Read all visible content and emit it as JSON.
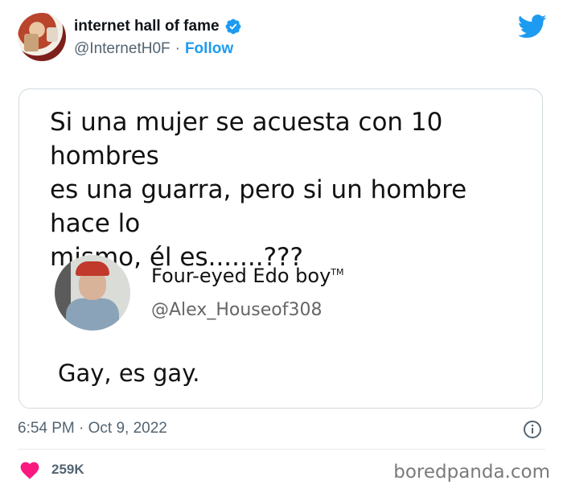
{
  "author": {
    "name": "internet hall of fame",
    "handle": "@InternetH0F",
    "separator": "·",
    "follow_label": "Follow",
    "avatar_icon": "avatar-image",
    "verified_icon": "verified-badge-icon"
  },
  "brand": {
    "logo_icon": "twitter-bird-icon",
    "color": "#1d9bf0"
  },
  "quoted": {
    "text": "Si una mujer se acuesta con 10 hombres\nes una guarra, pero si un hombre hace lo\nmismo, él es.......???",
    "reply_author_name": "Four-eyed Edo boy",
    "reply_author_tm": "TM",
    "reply_author_handle": "@Alex_Houseof308",
    "reply_text": "Gay, es gay."
  },
  "meta": {
    "timestamp": "6:54 PM · Oct 9, 2022",
    "info_icon": "info-icon",
    "likes": "259K",
    "like_icon": "heart-icon",
    "like_color": "#f91880"
  },
  "watermark": "boredpanda.com"
}
